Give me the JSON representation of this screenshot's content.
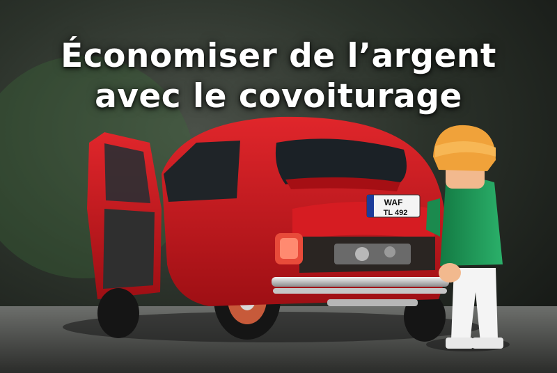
{
  "headline": {
    "line1": "Économiser de l’argent",
    "line2": "avec le covoiturage"
  },
  "scene": {
    "plate_line1": "WAF",
    "plate_line2": "TL 492",
    "colors": {
      "car_red": "#c8151a",
      "figure_shirt": "#1f9a58",
      "figure_hair": "#f0a23a",
      "background_dark": "#1c1e1a"
    }
  }
}
